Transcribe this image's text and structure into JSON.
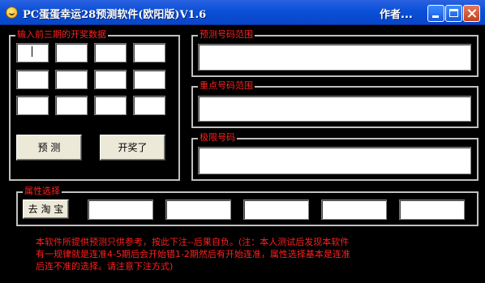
{
  "window": {
    "title": "PC蛋蛋幸运28预测软件(欧阳版)V1.6",
    "author": "作者..."
  },
  "input_group": {
    "legend": "输入前三期的开奖数据",
    "rows": [
      [
        "",
        "",
        "",
        ""
      ],
      [
        "",
        "",
        "",
        ""
      ],
      [
        "",
        "",
        "",
        ""
      ]
    ],
    "predict_label": "预  测",
    "drawn_label": "开奖了"
  },
  "predict_range": {
    "legend": "预测号码范围",
    "value": ""
  },
  "key_range": {
    "legend": "重点号码范围",
    "value": ""
  },
  "limit_numbers": {
    "legend": "极限号码",
    "value": ""
  },
  "attributes": {
    "legend": "属性选择",
    "taobao_label": "去 淘 宝",
    "fields": [
      "",
      "",
      "",
      "",
      ""
    ]
  },
  "disclaimer": {
    "line1": "本软件所提供预测只供参考，按此下注--后果自负。(注：本人测试后发现本软件",
    "line2": "有一规律就是连准4-5期后会开始错1-2期然后有开始连准，属性选择基本是连准",
    "line3": "后连不准的选择。请注意下注方式)"
  },
  "colors": {
    "title_bar": "#0a50d8",
    "background": "#000000",
    "legend_text": "#ff2020",
    "button_face": "#ece9d8"
  },
  "icons": [
    "app-icon",
    "minimize-icon",
    "maximize-icon",
    "close-icon"
  ]
}
